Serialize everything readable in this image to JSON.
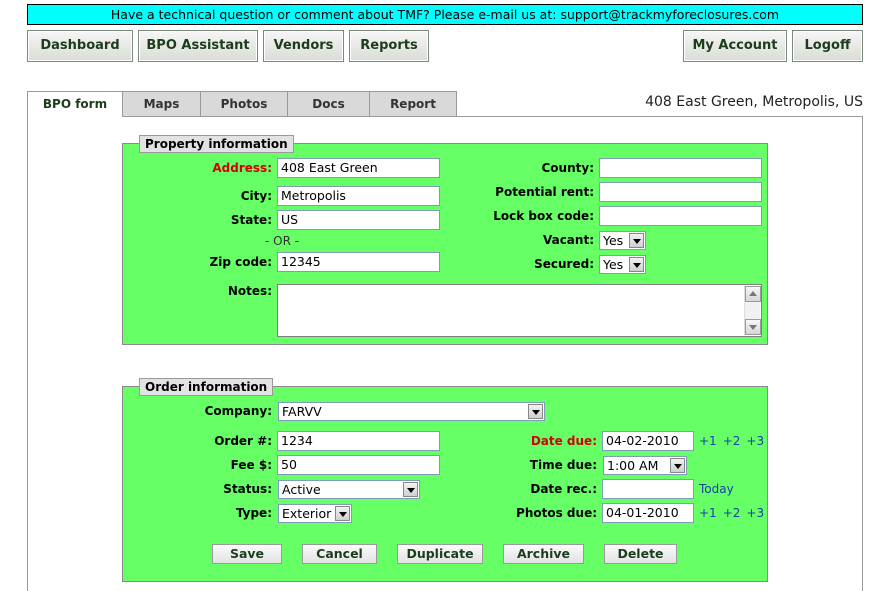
{
  "banner": {
    "text": "Have a technical question or comment about TMF?  Please e-mail us at: ",
    "email": "support@trackmyforeclosures.com"
  },
  "nav": {
    "dashboard": "Dashboard",
    "bpo_assistant": "BPO Assistant",
    "vendors": "Vendors",
    "reports": "Reports",
    "my_account": "My Account",
    "logoff": "Logoff"
  },
  "tabs": {
    "bpo_form": "BPO form",
    "maps": "Maps",
    "photos": "Photos",
    "docs": "Docs",
    "report": "Report"
  },
  "page_title": "408 East Green, Metropolis, US",
  "property": {
    "legend": "Property information",
    "address_label": "Address:",
    "address_value": "408 East Green",
    "city_label": "City:",
    "city_value": "Metropolis",
    "state_label": "State:",
    "state_value": "US",
    "or_text": "- OR -",
    "zip_label": "Zip code:",
    "zip_value": "12345",
    "county_label": "County:",
    "county_value": "",
    "rent_label": "Potential rent:",
    "rent_value": "",
    "lockbox_label": "Lock box code:",
    "lockbox_value": "",
    "vacant_label": "Vacant:",
    "vacant_value": "Yes",
    "secured_label": "Secured:",
    "secured_value": "Yes",
    "notes_label": "Notes:",
    "notes_value": ""
  },
  "order": {
    "legend": "Order information",
    "company_label": "Company:",
    "company_value": "FARVV",
    "order_label": "Order #:",
    "order_value": "1234",
    "fee_label": "Fee $:",
    "fee_value": "50",
    "status_label": "Status:",
    "status_value": "Active",
    "type_label": "Type:",
    "type_value": "Exterior",
    "date_due_label": "Date due:",
    "date_due_value": "04-02-2010",
    "time_due_label": "Time due:",
    "time_due_value": "1:00 AM",
    "date_rec_label": "Date rec.:",
    "date_rec_value": "",
    "today_link": "Today",
    "photos_due_label": "Photos due:",
    "photos_due_value": "04-01-2010",
    "plus1": "+1",
    "plus2": "+2",
    "plus3": "+3"
  },
  "actions": {
    "save": "Save",
    "cancel": "Cancel",
    "duplicate": "Duplicate",
    "archive": "Archive",
    "delete": "Delete"
  }
}
